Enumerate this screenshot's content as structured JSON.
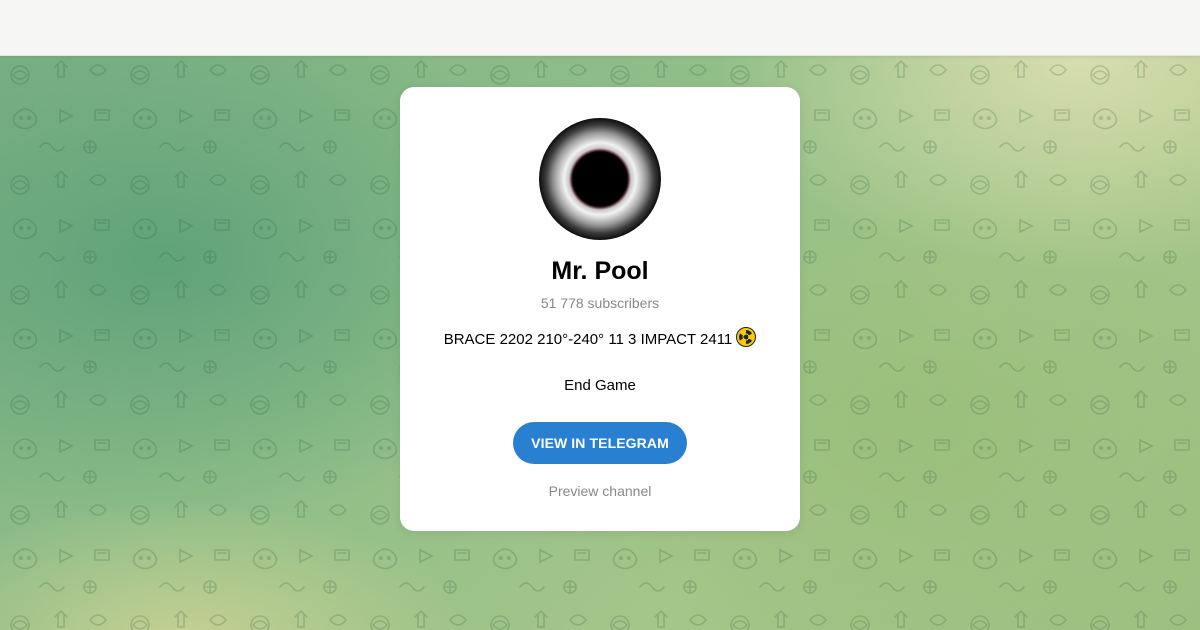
{
  "channel": {
    "name": "Mr. Pool",
    "subscribers": "51 778 subscribers",
    "description_line1": "BRACE 2202 210°-240° 11 3 IMPACT 2411",
    "description_emoji": "radioactive-icon",
    "description_line2": "End Game",
    "avatar": "eclipse-avatar"
  },
  "actions": {
    "view_button_label": "VIEW IN TELEGRAM",
    "preview_link_label": "Preview channel"
  },
  "colors": {
    "button": "#2a80d0",
    "background": "#8fbe88",
    "card": "#ffffff"
  }
}
